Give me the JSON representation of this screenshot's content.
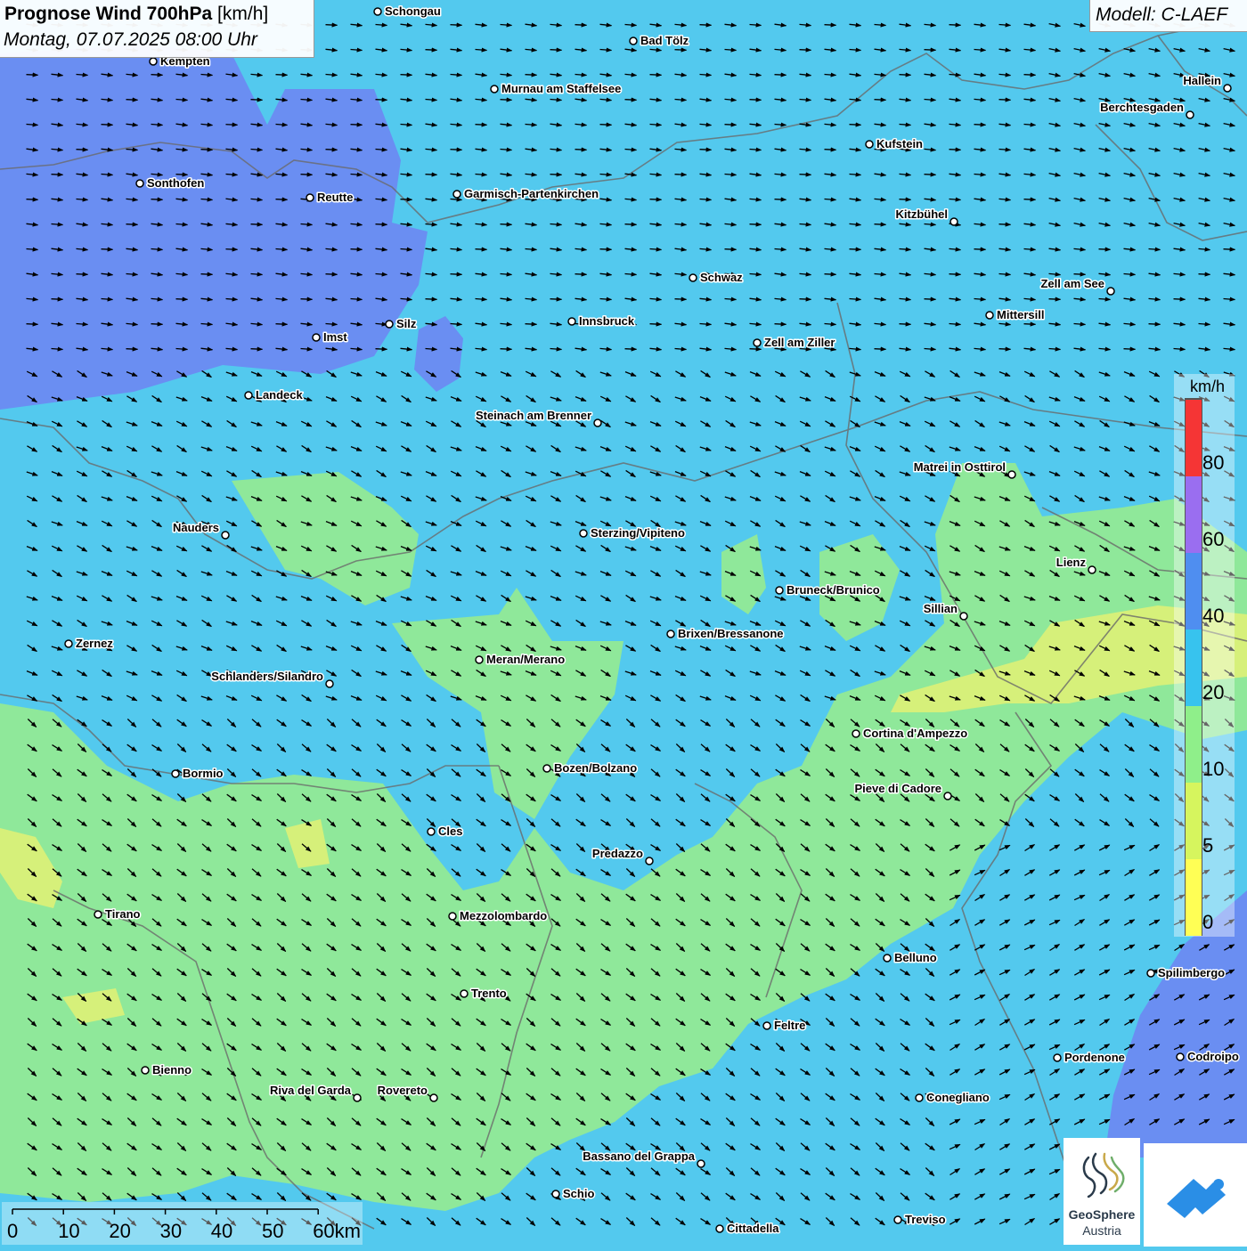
{
  "header": {
    "title_bold": "Prognose Wind 700hPa",
    "title_unit": "[km/h]",
    "datetime": "Montag, 07.07.2025 08:00 Uhr"
  },
  "model": {
    "label": "Modell: C-LAEF"
  },
  "legend": {
    "unit": "km/h",
    "segments": [
      {
        "color": "#ffff55"
      },
      {
        "color": "#d6f55e"
      },
      {
        "color": "#8fef8a"
      },
      {
        "color": "#37c3ee"
      },
      {
        "color": "#4f8ef0"
      },
      {
        "color": "#9a6ef0"
      },
      {
        "color": "#f53535"
      }
    ],
    "labels": [
      "0",
      "5",
      "10",
      "20",
      "40",
      "60",
      "80"
    ]
  },
  "scale": {
    "labels": [
      "0",
      "10",
      "20",
      "30",
      "40",
      "50",
      "60km"
    ]
  },
  "cities": [
    {
      "name": "Schongau"
    },
    {
      "name": "Bad Tölz"
    },
    {
      "name": "Kempten"
    },
    {
      "name": "Murnau am Staffelsee"
    },
    {
      "name": "Hallein"
    },
    {
      "name": "Berchtesgaden"
    },
    {
      "name": "Kufstein"
    },
    {
      "name": "Sonthofen"
    },
    {
      "name": "Reutte"
    },
    {
      "name": "Garmisch-Partenkirchen"
    },
    {
      "name": "Kitzbühel"
    },
    {
      "name": "Schwaz"
    },
    {
      "name": "Zell am See"
    },
    {
      "name": "Mittersill"
    },
    {
      "name": "Silz"
    },
    {
      "name": "Innsbruck"
    },
    {
      "name": "Imst"
    },
    {
      "name": "Zell am Ziller"
    },
    {
      "name": "Landeck"
    },
    {
      "name": "Steinach am Brenner"
    },
    {
      "name": "Matrei in Osttirol"
    },
    {
      "name": "Nauders"
    },
    {
      "name": "Sterzing/Vipiteno"
    },
    {
      "name": "Lienz"
    },
    {
      "name": "Bruneck/Brunico"
    },
    {
      "name": "Sillian"
    },
    {
      "name": "Brixen/Bressanone"
    },
    {
      "name": "Zernez"
    },
    {
      "name": "Meran/Merano"
    },
    {
      "name": "Schlanders/Silandro"
    },
    {
      "name": "Cortina d'Ampezzo"
    },
    {
      "name": "Bormio"
    },
    {
      "name": "Bozen/Bolzano"
    },
    {
      "name": "Pieve di Cadore"
    },
    {
      "name": "Cles"
    },
    {
      "name": "Predazzo"
    },
    {
      "name": "Tirano"
    },
    {
      "name": "Mezzolombardo"
    },
    {
      "name": "Belluno"
    },
    {
      "name": "Spilimbergo"
    },
    {
      "name": "Trento"
    },
    {
      "name": "Feltre"
    },
    {
      "name": "Pordenone"
    },
    {
      "name": "Codroipo"
    },
    {
      "name": "Bienno"
    },
    {
      "name": "Riva del Garda"
    },
    {
      "name": "Rovereto"
    },
    {
      "name": "Conegliano"
    },
    {
      "name": "Bassano del Grappa"
    },
    {
      "name": "Schio"
    },
    {
      "name": "Treviso"
    },
    {
      "name": "Cittadella"
    }
  ],
  "logos": {
    "geosphere_line1": "GeoSphere",
    "geosphere_line2": "Austria"
  }
}
